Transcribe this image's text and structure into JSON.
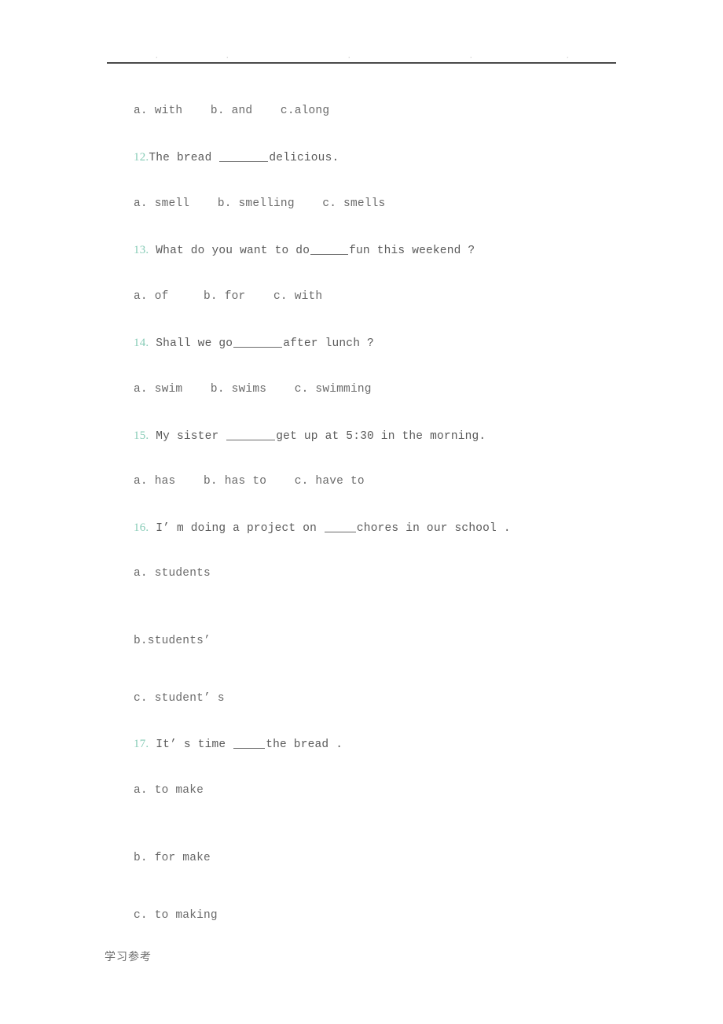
{
  "document": {
    "footer_text": "学习参考",
    "header_ghost_fragments": [
      ".",
      ".",
      ".",
      ".",
      "."
    ],
    "colors": {
      "question_number": "#86cbb6",
      "body_text": "#5a5a5a",
      "option_text": "#6a6a6a",
      "rule": "#4a4a4a",
      "background": "#ffffff"
    }
  },
  "content": {
    "orphan_options": {
      "label": "a. with    b. and    c.along"
    },
    "questions": [
      {
        "number": "12.",
        "text_before": "The bread ",
        "blank": "_______",
        "text_after": "delicious.",
        "options_inline": "a. smell    b. smelling    c. smells",
        "options": [
          "a. smell",
          "b. smelling",
          "c. smells"
        ]
      },
      {
        "number": "13.",
        "text_before": " What do you want to do",
        "blank": "______",
        "text_after": "fun this weekend ?",
        "options_inline": "a. of     b. for    c. with",
        "options": [
          "a. of",
          "b. for",
          "c. with"
        ]
      },
      {
        "number": "14.",
        "text_before": " Shall we go",
        "blank": "_______",
        "text_after": "after lunch ?",
        "options_inline": "a. swim    b. swims    c. swimming",
        "options": [
          "a. swim",
          "b. swims",
          "c. swimming"
        ]
      },
      {
        "number": "15.",
        "text_before": " My sister ",
        "blank": "_______",
        "text_after": "get up at 5:30 in the morning.",
        "options_inline": "a. has    b. has to    c. have to",
        "options": [
          "a. has",
          "b. has to",
          "c. have to"
        ]
      },
      {
        "number": "16.",
        "text_before": " I’ m doing a project on ",
        "blank": "_____",
        "text_after": "chores in our school .",
        "options_stacked": [
          "a. students",
          "b.students’",
          "c. student’ s"
        ]
      },
      {
        "number": "17.",
        "text_before": " It’ s time ",
        "blank": "_____",
        "text_after": "the bread .",
        "options_stacked": [
          "a. to make",
          "b. for make",
          "c. to making"
        ]
      }
    ]
  }
}
